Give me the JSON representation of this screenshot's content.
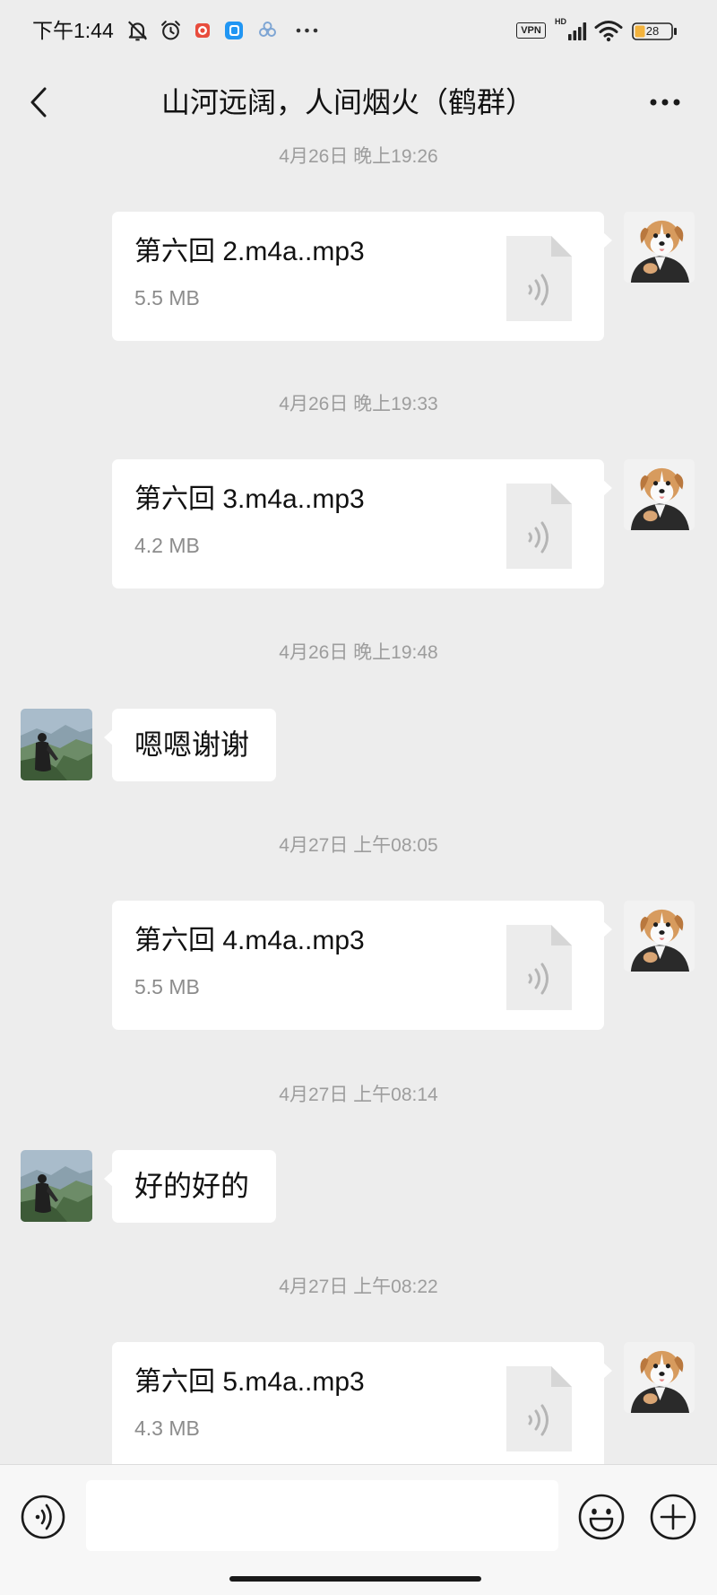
{
  "status_bar": {
    "time": "下午1:44",
    "left_icons": [
      "bell-off-icon",
      "alarm-icon",
      "screen-record-icon",
      "app-icon",
      "app-icon",
      "more-notifications-icon"
    ],
    "vpn": "VPN",
    "signal_label": "HD",
    "right_icons": [
      "signal-icon",
      "wifi-icon",
      "battery-icon"
    ],
    "battery": "28"
  },
  "header": {
    "title": "山河远阔，人间烟火（鹤群）",
    "back_icon": "chevron-left-icon",
    "menu_icon": "more-icon"
  },
  "avatars": {
    "self": "dog-in-suit-avatar",
    "other": "person-on-mountain-avatar"
  },
  "chat": [
    {
      "timestamp": "4月26日 晚上19:26",
      "file": {
        "name": "第六回 2.m4a..mp3",
        "size": "5.5 MB",
        "icon": "audio-file-icon"
      }
    },
    {
      "timestamp": "4月26日 晚上19:33",
      "file": {
        "name": "第六回 3.m4a..mp3",
        "size": "4.2 MB",
        "icon": "audio-file-icon"
      }
    },
    {
      "timestamp": "4月26日 晚上19:48",
      "text": "嗯嗯谢谢"
    },
    {
      "timestamp": "4月27日 上午08:05",
      "file": {
        "name": "第六回 4.m4a..mp3",
        "size": "5.5 MB",
        "icon": "audio-file-icon"
      }
    },
    {
      "timestamp": "4月27日 上午08:14",
      "text": "好的好的"
    },
    {
      "timestamp": "4月27日 上午08:22",
      "file": {
        "name": "第六回 5.m4a..mp3",
        "size": "4.3 MB",
        "icon": "audio-file-icon"
      }
    }
  ],
  "input_bar": {
    "value": "",
    "voice_icon": "voice-icon",
    "emoji_icon": "emoji-icon",
    "plus_icon": "plus-icon"
  },
  "colors": {
    "background": "#ededed",
    "bubble": "#ffffff",
    "timestamp": "#9d9d9d",
    "file_size": "#8c8c8c",
    "input_bar": "#f7f7f7",
    "battery_fill": "#f3b33d",
    "record_badge": "#e84c3d",
    "app_badge": "#2196f3"
  }
}
